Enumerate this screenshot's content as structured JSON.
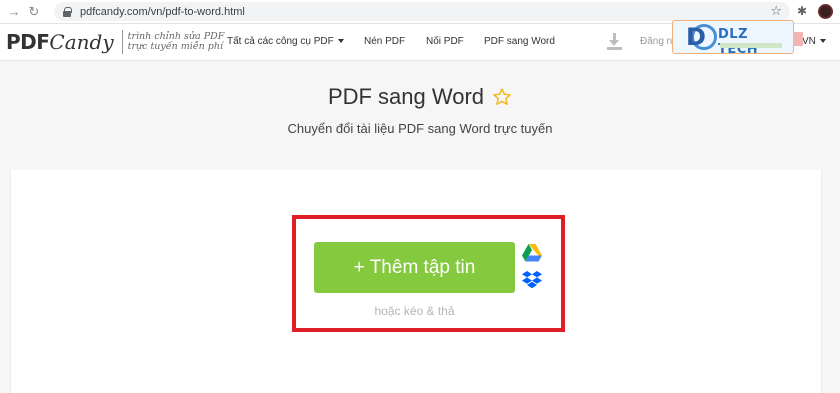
{
  "browser": {
    "url": "pdfcandy.com/vn/pdf-to-word.html",
    "back_icon": "arrow-right-icon",
    "reload_icon": "reload-icon"
  },
  "header": {
    "logo_pdf": "PDF",
    "logo_candy": "Candy",
    "tagline_line1": "trình chỉnh sửa PDF",
    "tagline_line2": "trực tuyến miễn phí",
    "nav": {
      "all_tools": "Tất cả các công cụ PDF",
      "compress": "Nén PDF",
      "merge": "Nối PDF",
      "pdf_to_word": "PDF sang Word"
    },
    "login": "Đăng n",
    "language": "VN"
  },
  "watermark": {
    "letter": "D",
    "text": "DLZ TECH"
  },
  "main": {
    "title": "PDF sang Word",
    "subtitle": "Chuyển đổi tài liệu PDF sang Word trực tuyến",
    "add_file_button": "+ Thêm tập tin",
    "drag_hint": "hoặc kéo & thả"
  },
  "colors": {
    "accent_green": "#85c93f",
    "highlight_red": "#e01e25",
    "star_yellow": "#f5b820"
  }
}
